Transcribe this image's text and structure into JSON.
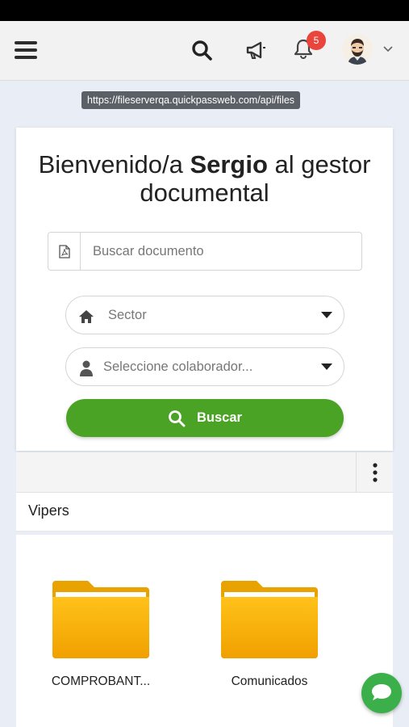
{
  "topbar": {
    "menu_icon": "hamburger-menu-icon",
    "search_icon": "search-icon",
    "announcement_icon": "megaphone-icon",
    "notification_icon": "bell-icon",
    "notification_count": "5",
    "avatar_icon": "user-avatar",
    "dropdown_icon": "chevron-down-icon"
  },
  "url_tooltip": "https://fileserverqa.quickpassweb.com/api/files",
  "welcome": {
    "prefix": "Bienvenido/a ",
    "user": "Sergio",
    "suffix": " al gestor documental"
  },
  "doc_search": {
    "placeholder": "Buscar documento",
    "icon": "pdf-file-icon"
  },
  "sector_select": {
    "value": "Sector",
    "icon": "home-icon"
  },
  "collaborator_select": {
    "value": "Seleccione colaborador...",
    "icon": "user-icon"
  },
  "search_button": {
    "label": "Buscar",
    "icon": "search-icon"
  },
  "toolbar": {
    "more_icon": "kebab-menu-icon"
  },
  "group": {
    "title": "Vipers"
  },
  "folders": [
    {
      "label": "COMPROBANT...",
      "icon": "folder-icon"
    },
    {
      "label": "Comunicados",
      "icon": "folder-icon"
    }
  ],
  "chat": {
    "icon": "chat-bubble-icon"
  },
  "colors": {
    "primary_green": "#4aa324",
    "badge_red": "#e9453c",
    "folder_yellow": "#f5b800",
    "chat_green": "#3bb04a"
  }
}
